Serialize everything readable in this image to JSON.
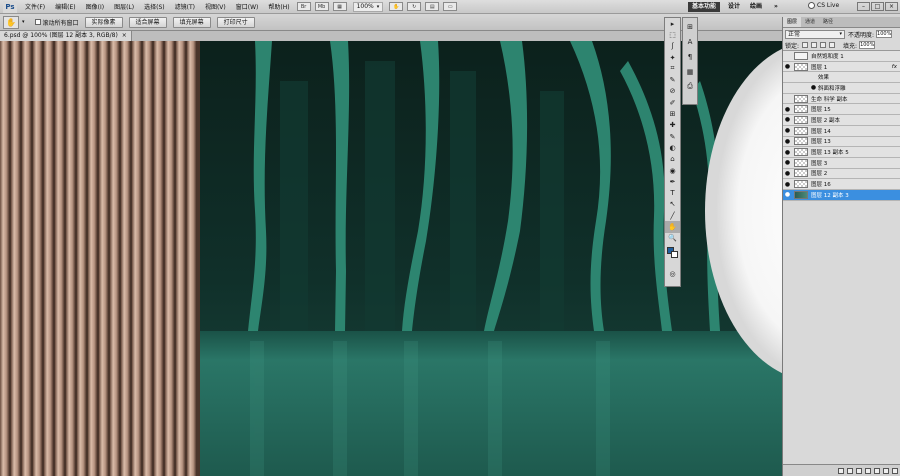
{
  "menubar": {
    "logo": "Ps",
    "items": [
      "文件(F)",
      "编辑(E)",
      "图像(I)",
      "图层(L)",
      "选择(S)",
      "滤镜(T)",
      "视图(V)",
      "窗口(W)",
      "帮助(H)"
    ],
    "zoom": "100%",
    "workspace_active": "基本功能",
    "workspace_items": [
      "设计",
      "绘画"
    ],
    "more": "»",
    "cs_live": "CS Live",
    "window_buttons": [
      "–",
      "□",
      "×"
    ]
  },
  "options": {
    "checkbox_label": "滚动所有窗口",
    "buttons": [
      "实际像素",
      "适合屏幕",
      "填充屏幕",
      "打印尺寸"
    ]
  },
  "document": {
    "tab_title": "6.psd @ 100% (图层 12 副本 3, RGB/8)",
    "close": "×"
  },
  "colors": {
    "foreground": "#1f5fa0",
    "background": "#ffffff",
    "teal_dark": "#0f2a24",
    "teal_light": "#4aa58f",
    "floor": "#2a7667",
    "selected_layer": "#3b8fe0"
  },
  "layers_panel": {
    "tabs": [
      "图层",
      "通道",
      "路径"
    ],
    "blend_mode": "正常",
    "opacity_label": "不透明度:",
    "opacity_value": "100%",
    "lock_label": "锁定:",
    "fill_label": "填充:",
    "fill_value": "100%",
    "layers": [
      {
        "name": "自然饱和度 1",
        "eye": "",
        "kind": "adj",
        "fx": "",
        "selected": false
      },
      {
        "name": "图层 1",
        "eye": "●",
        "kind": "checker",
        "fx": "fx",
        "selected": false
      },
      {
        "name": "效果",
        "eye": "",
        "kind": "sub",
        "fx": "",
        "selected": false
      },
      {
        "name": "斜面和浮雕",
        "eye": "●",
        "kind": "sub",
        "fx": "",
        "selected": false
      },
      {
        "name": "生命 科学 副本",
        "eye": "",
        "kind": "checker",
        "fx": "",
        "selected": false
      },
      {
        "name": "图层 15",
        "eye": "●",
        "kind": "checker",
        "fx": "",
        "selected": false
      },
      {
        "name": "图层 2 副本",
        "eye": "●",
        "kind": "checker",
        "fx": "",
        "selected": false
      },
      {
        "name": "图层 14",
        "eye": "●",
        "kind": "checker",
        "fx": "",
        "selected": false
      },
      {
        "name": "图层 13",
        "eye": "●",
        "kind": "checker",
        "fx": "",
        "selected": false
      },
      {
        "name": "图层 13 副本 5",
        "eye": "●",
        "kind": "checker",
        "fx": "",
        "selected": false
      },
      {
        "name": "图层 3",
        "eye": "●",
        "kind": "checker",
        "fx": "",
        "selected": false
      },
      {
        "name": "图层 2",
        "eye": "●",
        "kind": "checker",
        "fx": "",
        "selected": false
      },
      {
        "name": "图层 16",
        "eye": "●",
        "kind": "checker",
        "fx": "",
        "selected": false
      },
      {
        "name": "图层 12 副本 3",
        "eye": "●",
        "kind": "dark",
        "fx": "",
        "selected": true
      }
    ]
  },
  "tools": [
    "▸",
    "⬚",
    "ʃ",
    "✦",
    "⌗",
    "✎",
    "⊘",
    "✐",
    "⊞",
    "✚",
    "✎",
    "◐",
    "⌂",
    "◉",
    "✒",
    "T",
    "↖",
    "╱",
    "✋",
    "🔍"
  ],
  "dock": [
    "⊞",
    "A",
    "¶",
    "▦",
    "⎙"
  ]
}
